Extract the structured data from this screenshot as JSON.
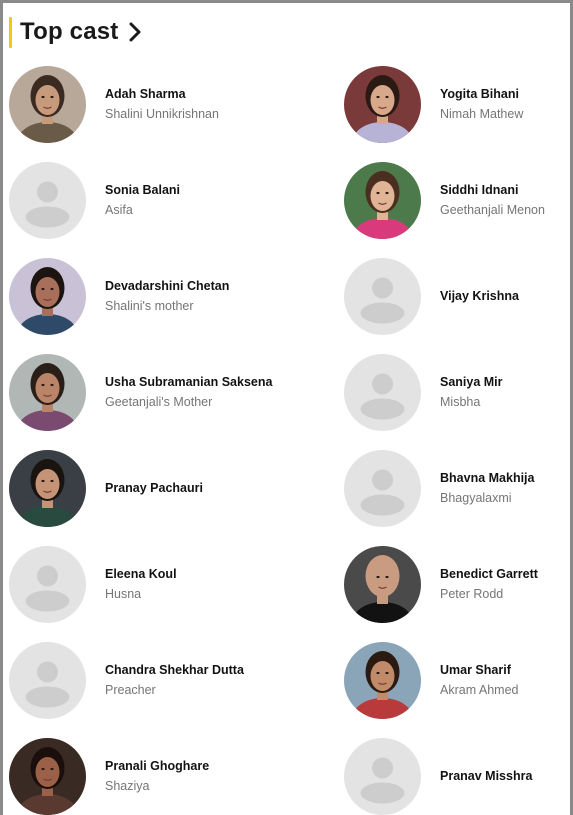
{
  "section": {
    "title": "Top cast"
  },
  "cast": [
    {
      "name": "Adah Sharma",
      "role": "Shalini Unnikrishnan",
      "photo": true,
      "skin": "#c89a7c",
      "hair": "#3b2a22",
      "bg": "#b8a89a",
      "shirt": "#6a5a48"
    },
    {
      "name": "Yogita Bihani",
      "role": "Nimah Mathew",
      "photo": true,
      "skin": "#d7a88a",
      "hair": "#2b1a14",
      "bg": "#7a3a3a",
      "shirt": "#b7b3d6"
    },
    {
      "name": "Sonia Balani",
      "role": "Asifa",
      "photo": false
    },
    {
      "name": "Siddhi Idnani",
      "role": "Geethanjali Menon",
      "photo": true,
      "skin": "#e0b495",
      "hair": "#4a2e20",
      "bg": "#4d7a4a",
      "shirt": "#d83a7c"
    },
    {
      "name": "Devadarshini Chetan",
      "role": "Shalini's mother",
      "photo": true,
      "skin": "#a8705a",
      "hair": "#1c1410",
      "bg": "#c9c2d6",
      "shirt": "#2e4a68"
    },
    {
      "name": "Vijay Krishna",
      "role": "",
      "photo": false
    },
    {
      "name": "Usha Subramanian Saksena",
      "role": "Geetanjali's Mother",
      "photo": true,
      "skin": "#b98468",
      "hair": "#2a1e18",
      "bg": "#b0b7b4",
      "shirt": "#7a4a70"
    },
    {
      "name": "Saniya Mir",
      "role": "Misbha",
      "photo": false
    },
    {
      "name": "Pranay Pachauri",
      "role": "",
      "photo": true,
      "skin": "#c59476",
      "hair": "#1a1410",
      "bg": "#3a3f46",
      "shirt": "#294a3e"
    },
    {
      "name": "Bhavna Makhija",
      "role": "Bhagyalaxmi",
      "photo": false
    },
    {
      "name": "Eleena Koul",
      "role": "Husna",
      "photo": false
    },
    {
      "name": "Benedict Garrett",
      "role": "Peter Rodd",
      "photo": true,
      "skin": "#c99b80",
      "hair": "#c99b80",
      "bg": "#4a4a4a",
      "shirt": "#121212"
    },
    {
      "name": "Chandra Shekhar Dutta",
      "role": "Preacher",
      "photo": false
    },
    {
      "name": "Umar Sharif",
      "role": "Akram Ahmed",
      "photo": true,
      "skin": "#c18b6a",
      "hair": "#2a1a12",
      "bg": "#8aa4b8",
      "shirt": "#b83a3a"
    },
    {
      "name": "Pranali Ghoghare",
      "role": "Shaziya",
      "photo": true,
      "skin": "#9a6048",
      "hair": "#1a0f0c",
      "bg": "#3a2a24",
      "shirt": "#5a3a30"
    },
    {
      "name": "Pranav Misshra",
      "role": "",
      "photo": false
    }
  ]
}
